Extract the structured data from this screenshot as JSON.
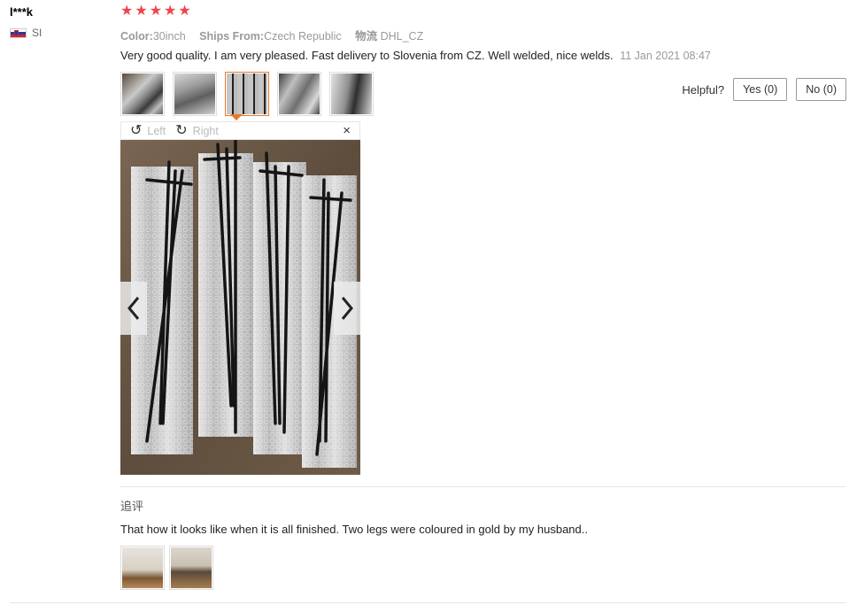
{
  "user": {
    "name": "l***k",
    "country_code": "SI"
  },
  "review": {
    "rating": 5,
    "stars": [
      "★",
      "★",
      "★",
      "★",
      "★"
    ],
    "attributes": [
      {
        "key": "Color:",
        "value": "30inch"
      },
      {
        "key": "Ships From:",
        "value": "Czech Republic"
      },
      {
        "key": "物流",
        "value": "DHL_CZ"
      }
    ],
    "text": "Very good quality. I am very pleased. Fast delivery to Slovenia from CZ. Well welded, nice welds.",
    "date": "11 Jan 2021 08:47",
    "thumbnail_count": 5,
    "active_thumbnail": 3
  },
  "helpful": {
    "label": "Helpful?",
    "yes": "Yes (0)",
    "no": "No (0)"
  },
  "viewer": {
    "rotate_left": "Left",
    "rotate_right": "Right",
    "close": "×",
    "prev": "‹",
    "next": "›"
  },
  "followup": {
    "label": "追评",
    "text": "That how it looks like when it is all finished. Two legs were coloured in gold by my husband..",
    "thumbnail_count": 2
  },
  "colors": {
    "star": "#f0444b",
    "active_thumb_border": "#e8782a"
  }
}
